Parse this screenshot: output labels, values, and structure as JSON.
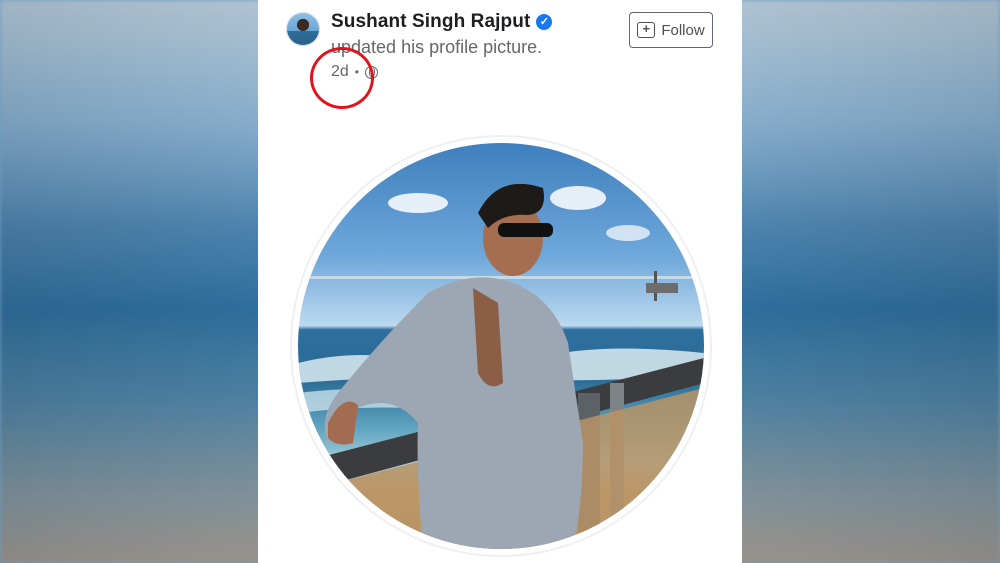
{
  "post": {
    "author_name": "Sushant Singh Rajput",
    "verified": true,
    "activity_text": "updated his profile picture.",
    "timestamp": "2d",
    "separator": "•",
    "audience_icon": "globe-icon",
    "follow_label": "Follow",
    "follow_icon": "add-follow-icon"
  },
  "colors": {
    "highlight": "#e0141e",
    "verified_badge": "#1877f2",
    "text_primary": "#1c1e21",
    "text_secondary": "#65676b"
  }
}
